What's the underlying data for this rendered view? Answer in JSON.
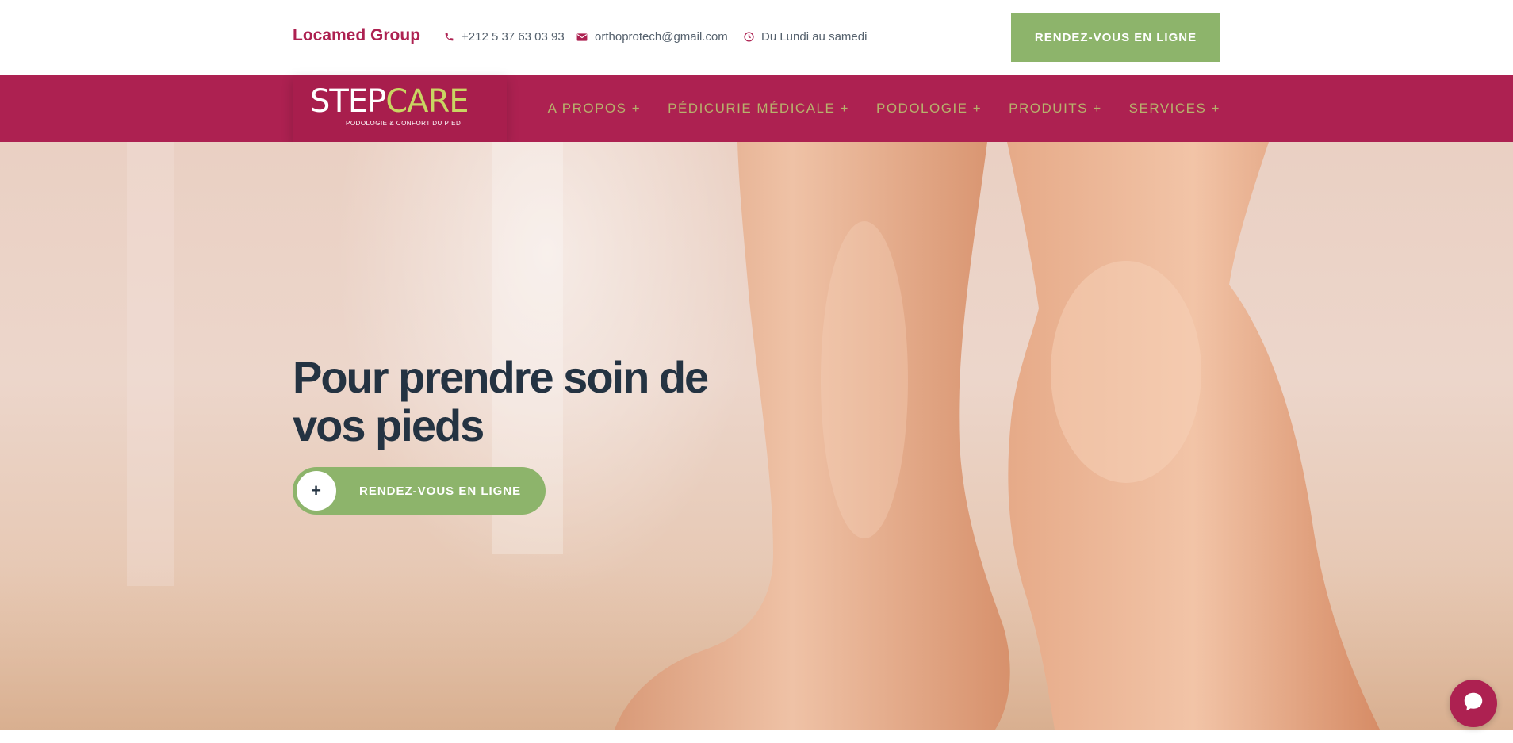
{
  "header": {
    "brand": "Locamed Group",
    "phone": "+212 5 37 63 03 93",
    "email": "orthoprotech@gmail.com",
    "hours": "Du Lundi au samedi",
    "cta_label": "RENDEZ-VOUS EN LIGNE"
  },
  "logo": {
    "step": "STEP",
    "care": "CARE",
    "tagline": "PODOLOGIE & CONFORT DU PIED"
  },
  "nav": {
    "items": [
      "A PROPOS +",
      "PÉDICURIE MÉDICALE +",
      "PODOLOGIE +",
      "PRODUITS +",
      "SERVICES +"
    ]
  },
  "hero": {
    "title": "Pour prendre soin de vos pieds",
    "button_label": "RENDEZ-VOUS EN LIGNE",
    "button_icon": "+"
  },
  "icons": {
    "phone": "phone-icon",
    "email": "envelope-icon",
    "hours": "clock-icon",
    "chat": "chat-bubble-icon"
  },
  "colors": {
    "brand": "#ad2151",
    "accent_green": "#8db46b",
    "nav_text": "#b7b16c",
    "hero_title": "#243342"
  }
}
